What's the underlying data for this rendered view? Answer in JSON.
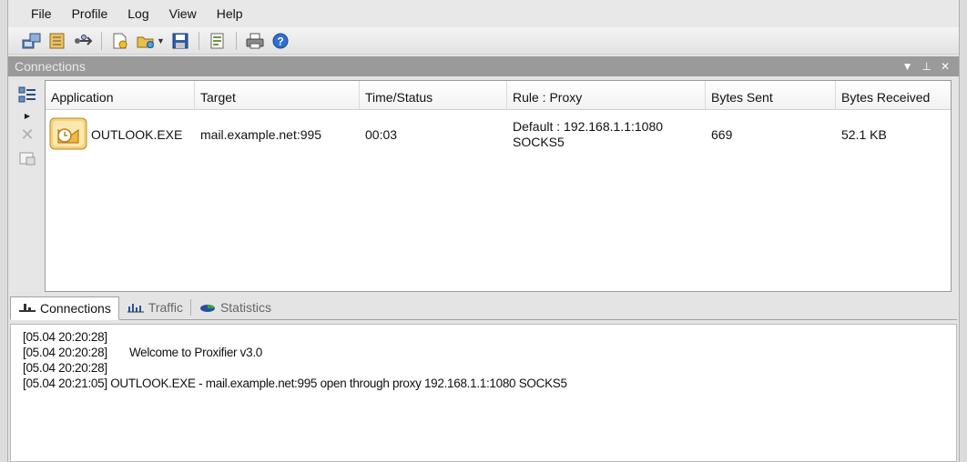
{
  "menu": [
    "File",
    "Profile",
    "Log",
    "View",
    "Help"
  ],
  "toolbar": {
    "buttons": [
      "connections-icon",
      "rules-icon",
      "proxy-icon",
      "new-profile-icon",
      "open-profile-icon",
      "save-profile-icon",
      "log-icon",
      "print-icon",
      "help-icon"
    ]
  },
  "panel": {
    "title": "Connections"
  },
  "table": {
    "headers": [
      "Application",
      "Target",
      "Time/Status",
      "Rule : Proxy",
      "Bytes Sent",
      "Bytes Received"
    ],
    "rows": [
      {
        "application": "OUTLOOK.EXE",
        "target": "mail.example.net:995",
        "time_status": "00:03",
        "rule_proxy_line1": "Default : 192.168.1.1:1080",
        "rule_proxy_line2": "SOCKS5",
        "bytes_sent": "669",
        "bytes_received": "52.1 KB"
      }
    ]
  },
  "tabs": [
    "Connections",
    "Traffic",
    "Statistics"
  ],
  "log": [
    "[05.04 20:20:28]",
    "[05.04 20:20:28]       Welcome to Proxifier v3.0",
    "[05.04 20:20:28]",
    "[05.04 20:21:05] OUTLOOK.EXE - mail.example.net:995 open through proxy 192.168.1.1:1080 SOCKS5"
  ]
}
